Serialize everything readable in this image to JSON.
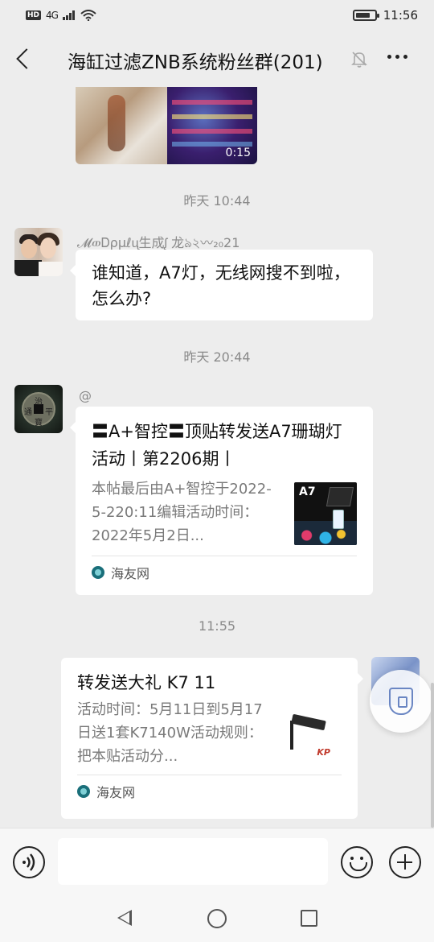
{
  "status_bar": {
    "hd": "HD",
    "network": "4G",
    "time": "11:56",
    "battery_level": 0.8
  },
  "header": {
    "title": "海缸过滤ZNB系统粉丝群(201)",
    "back_icon": "chevron-left-icon",
    "mute_icon": "bell-off-icon",
    "more_icon": "more-dots-icon"
  },
  "messages": {
    "video": {
      "duration": "0:15"
    },
    "ts1": "昨天 10:44",
    "msg1": {
      "sender": "𝓜ወᎠρμℓᶙ生成ᶘ 龙ঌ২〰₂₀21",
      "text": "谁知道，A7灯，无线网搜不到啦，怎么办?"
    },
    "ts2": "昨天 20:44",
    "msg2": {
      "sender": "@",
      "card_title": "〓A+智控〓顶贴转发送A7珊瑚灯活动丨第2206期丨",
      "card_desc": "本帖最后由A+智控于2022-5-220:11编辑活动时间：2022年5月2日...",
      "thumb_label": "A7",
      "source": "海友网"
    },
    "ts3": "11:55",
    "msg3": {
      "card_title": "转发送大礼 K7 11",
      "card_desc": "活动时间：5月11日到5月17日送1套K7140W活动规则：把本贴活动分...",
      "thumb_logo": "KP",
      "source": "海友网"
    }
  },
  "input_bar": {
    "placeholder": "",
    "voice_icon": "voice-icon",
    "emoji_icon": "emoji-icon",
    "plus_icon": "plus-icon"
  },
  "nav_bar": {
    "back_icon": "nav-back-icon",
    "home_icon": "nav-home-icon",
    "recent_icon": "nav-recent-icon"
  }
}
